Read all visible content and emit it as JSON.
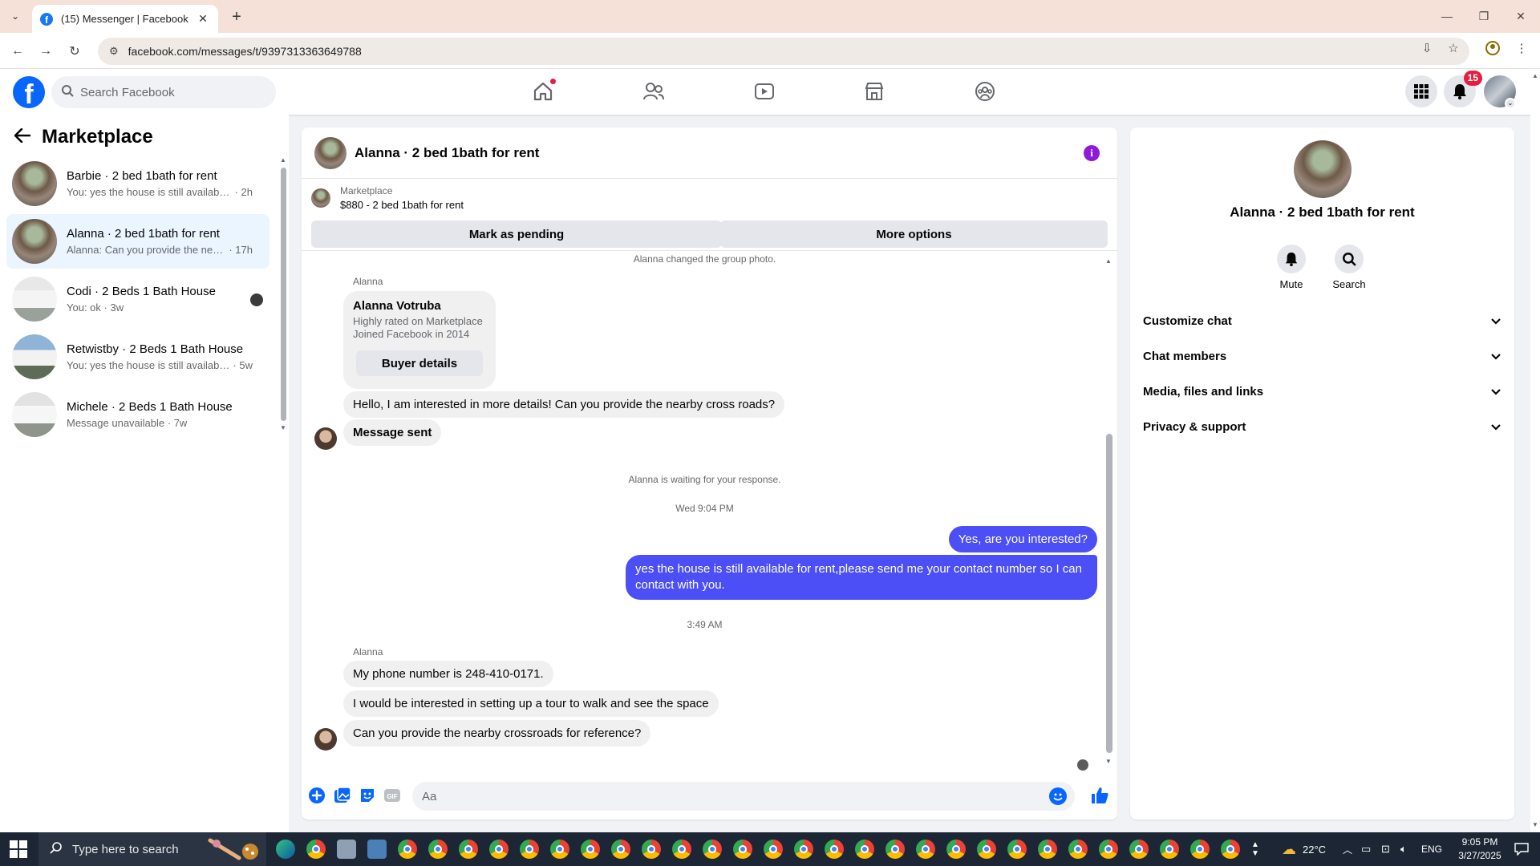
{
  "browser": {
    "tab_title": "(15) Messenger | Facebook",
    "url": "facebook.com/messages/t/9397313363649788"
  },
  "header": {
    "search_placeholder": "Search Facebook",
    "notifications_count": "15",
    "brand_color": "#0866ff"
  },
  "sidebar": {
    "title": "Marketplace",
    "conversations": [
      {
        "name": "Barbie · 2 bed 1bath for rent",
        "preview": "You: yes the house is still available f...",
        "time": "· 2h"
      },
      {
        "name": "Alanna · 2 bed 1bath for rent",
        "preview": "Alanna: Can you provide the near...",
        "time": "· 17h"
      },
      {
        "name": "Codi · 2 Beds 1 Bath House",
        "preview": "You: ok",
        "time": "· 3w"
      },
      {
        "name": "Retwistby · 2 Beds 1 Bath House",
        "preview": "You: yes the house is still available ...",
        "time": "· 5w"
      },
      {
        "name": "Michele · 2 Beds 1 Bath House",
        "preview": "Message unavailable",
        "time": "· 7w"
      }
    ]
  },
  "chat": {
    "title": "Alanna · 2 bed 1bath for rent",
    "marketplace_label": "Marketplace",
    "listing": "$880 - 2 bed 1bath for rent",
    "mark_pending_label": "Mark as pending",
    "more_options_label": "More options",
    "system_group_photo": "Alanna changed the group photo.",
    "sender_name": "Alanna",
    "card": {
      "name": "Alanna Votruba",
      "line1": "Highly rated on Marketplace",
      "line2": "Joined Facebook in 2014",
      "button": "Buyer details"
    },
    "msg_interest": "Hello, I am interested in more details!  Can you provide the nearby cross roads?",
    "msg_sent": "Message sent",
    "system_waiting": "Alanna is waiting for your response.",
    "time1": "Wed 9:04 PM",
    "out1": "Yes, are you interested?",
    "out2_line1": "yes the house is still available for rent,please send me your contact number so I can",
    "out2_line2": "contact with you.",
    "time2": "3:49 AM",
    "in_phone": "My phone number is 248-410-0171.",
    "in_tour": "I would be interested in setting up a tour to walk and see the space",
    "in_cross": "Can you provide the nearby crossroads for reference?",
    "composer_placeholder": "Aa",
    "outgoing_color": "#4b4ff5"
  },
  "details": {
    "name": "Alanna · 2 bed 1bath for rent",
    "mute_label": "Mute",
    "search_label": "Search",
    "sections": [
      "Customize chat",
      "Chat members",
      "Media, files and links",
      "Privacy & support"
    ]
  },
  "taskbar": {
    "search_placeholder": "Type here to search",
    "temperature": "22°C",
    "language": "ENG",
    "time": "9:05 PM",
    "date": "3/27/2025"
  }
}
